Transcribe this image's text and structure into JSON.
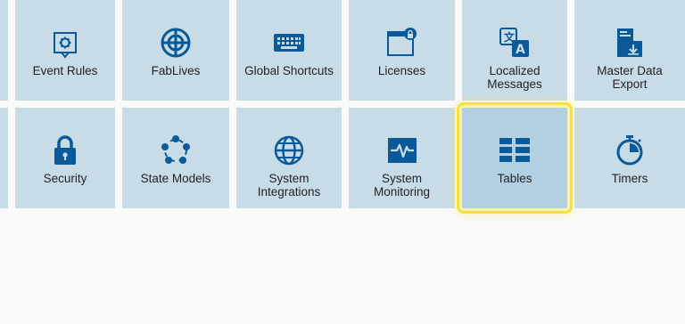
{
  "tiles_row1": [
    {
      "label": "Event Rules",
      "icon": "event-rules-icon"
    },
    {
      "label": "FabLives",
      "icon": "fablives-icon"
    },
    {
      "label": "Global Shortcuts",
      "icon": "keyboard-icon"
    },
    {
      "label": "Licenses",
      "icon": "licenses-icon"
    },
    {
      "label": "Localized\nMessages",
      "icon": "translate-icon"
    },
    {
      "label": "Master Data\nExport",
      "icon": "export-icon"
    }
  ],
  "tiles_row2": [
    {
      "label": "Security",
      "icon": "lock-icon"
    },
    {
      "label": "State Models",
      "icon": "state-cycle-icon"
    },
    {
      "label": "System\nIntegrations",
      "icon": "globe-icon"
    },
    {
      "label": "System\nMonitoring",
      "icon": "pulse-monitor-icon"
    },
    {
      "label": "Tables",
      "icon": "table-icon",
      "selected": true
    },
    {
      "label": "Timers",
      "icon": "stopwatch-icon"
    }
  ],
  "colors": {
    "tile_bg": "#c8dce8",
    "tile_selected_bg": "#b3d0e3",
    "icon": "#0a5a99",
    "highlight": "#f4e23a",
    "page_bg": "#fafafa"
  }
}
